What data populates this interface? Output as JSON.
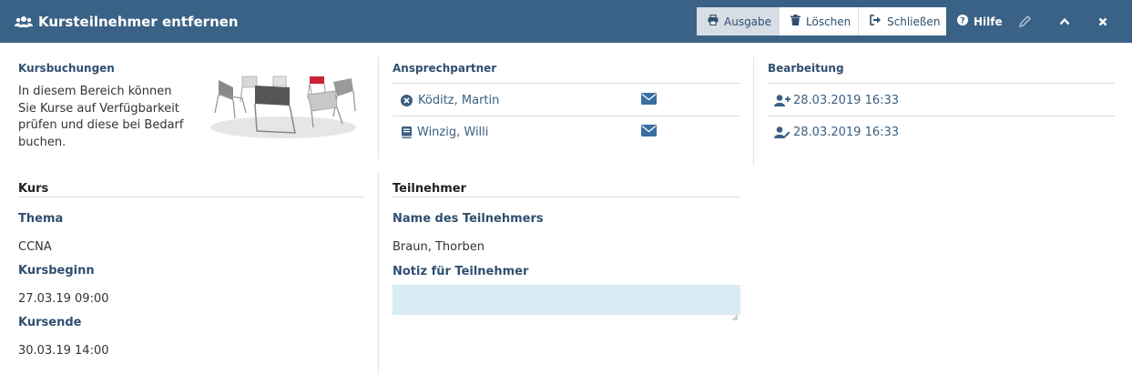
{
  "header": {
    "title": "Kursteilnehmer entfernen",
    "buttons": {
      "ausgabe": "Ausgabe",
      "loeschen": "Löschen",
      "schliessen": "Schließen",
      "hilfe": "Hilfe"
    },
    "icons": [
      "users-icon",
      "print-icon",
      "trash-icon",
      "sign-out-icon",
      "question-circle-icon",
      "pencil-icon",
      "chevron-up-icon",
      "close-icon"
    ]
  },
  "kursbuchungen": {
    "label": "Kursbuchungen",
    "description": "In diesem Bereich können Sie Kurse auf Verfügbarkeit prüfen und diese bei Bedarf buchen."
  },
  "ansprechpartner": {
    "label": "Ansprechpartner",
    "contacts": [
      {
        "name": "Köditz, Martin",
        "icon": "times-circle-icon"
      },
      {
        "name": "Winzig, Willi",
        "icon": "book-icon"
      }
    ]
  },
  "bearbeitung": {
    "label": "Bearbeitung",
    "created": "28.03.2019 16:33",
    "edited": "28.03.2019 16:33"
  },
  "kurs": {
    "heading": "Kurs",
    "thema_label": "Thema",
    "thema": "CCNA",
    "beginn_label": "Kursbeginn",
    "beginn": "27.03.19 09:00",
    "ende_label": "Kursende",
    "ende": "30.03.19 14:00"
  },
  "teilnehmer": {
    "heading": "Teilnehmer",
    "name_label": "Name des Teilnehmers",
    "name": "Braun, Thorben",
    "notiz_label": "Notiz für Teilnehmer",
    "notiz_value": ""
  },
  "colors": {
    "header_bg": "#3a6286",
    "accent": "#3a6286",
    "notiz_bg": "#d9ebf4"
  }
}
